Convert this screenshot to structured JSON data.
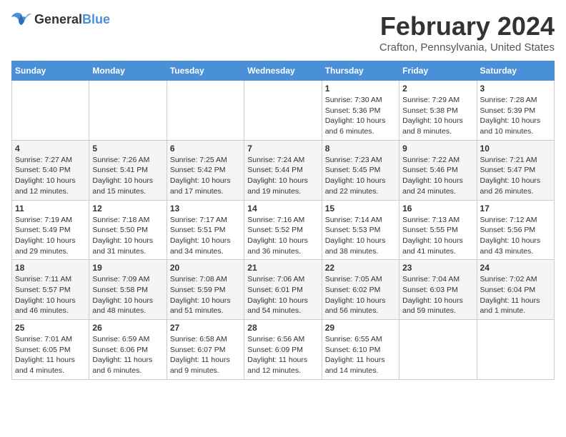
{
  "header": {
    "logo": {
      "general": "General",
      "blue": "Blue"
    },
    "title": "February 2024",
    "location": "Crafton, Pennsylvania, United States"
  },
  "weekdays": [
    "Sunday",
    "Monday",
    "Tuesday",
    "Wednesday",
    "Thursday",
    "Friday",
    "Saturday"
  ],
  "weeks": [
    [
      {
        "day": "",
        "info": ""
      },
      {
        "day": "",
        "info": ""
      },
      {
        "day": "",
        "info": ""
      },
      {
        "day": "",
        "info": ""
      },
      {
        "day": "1",
        "info": "Sunrise: 7:30 AM\nSunset: 5:36 PM\nDaylight: 10 hours\nand 6 minutes."
      },
      {
        "day": "2",
        "info": "Sunrise: 7:29 AM\nSunset: 5:38 PM\nDaylight: 10 hours\nand 8 minutes."
      },
      {
        "day": "3",
        "info": "Sunrise: 7:28 AM\nSunset: 5:39 PM\nDaylight: 10 hours\nand 10 minutes."
      }
    ],
    [
      {
        "day": "4",
        "info": "Sunrise: 7:27 AM\nSunset: 5:40 PM\nDaylight: 10 hours\nand 12 minutes."
      },
      {
        "day": "5",
        "info": "Sunrise: 7:26 AM\nSunset: 5:41 PM\nDaylight: 10 hours\nand 15 minutes."
      },
      {
        "day": "6",
        "info": "Sunrise: 7:25 AM\nSunset: 5:42 PM\nDaylight: 10 hours\nand 17 minutes."
      },
      {
        "day": "7",
        "info": "Sunrise: 7:24 AM\nSunset: 5:44 PM\nDaylight: 10 hours\nand 19 minutes."
      },
      {
        "day": "8",
        "info": "Sunrise: 7:23 AM\nSunset: 5:45 PM\nDaylight: 10 hours\nand 22 minutes."
      },
      {
        "day": "9",
        "info": "Sunrise: 7:22 AM\nSunset: 5:46 PM\nDaylight: 10 hours\nand 24 minutes."
      },
      {
        "day": "10",
        "info": "Sunrise: 7:21 AM\nSunset: 5:47 PM\nDaylight: 10 hours\nand 26 minutes."
      }
    ],
    [
      {
        "day": "11",
        "info": "Sunrise: 7:19 AM\nSunset: 5:49 PM\nDaylight: 10 hours\nand 29 minutes."
      },
      {
        "day": "12",
        "info": "Sunrise: 7:18 AM\nSunset: 5:50 PM\nDaylight: 10 hours\nand 31 minutes."
      },
      {
        "day": "13",
        "info": "Sunrise: 7:17 AM\nSunset: 5:51 PM\nDaylight: 10 hours\nand 34 minutes."
      },
      {
        "day": "14",
        "info": "Sunrise: 7:16 AM\nSunset: 5:52 PM\nDaylight: 10 hours\nand 36 minutes."
      },
      {
        "day": "15",
        "info": "Sunrise: 7:14 AM\nSunset: 5:53 PM\nDaylight: 10 hours\nand 38 minutes."
      },
      {
        "day": "16",
        "info": "Sunrise: 7:13 AM\nSunset: 5:55 PM\nDaylight: 10 hours\nand 41 minutes."
      },
      {
        "day": "17",
        "info": "Sunrise: 7:12 AM\nSunset: 5:56 PM\nDaylight: 10 hours\nand 43 minutes."
      }
    ],
    [
      {
        "day": "18",
        "info": "Sunrise: 7:11 AM\nSunset: 5:57 PM\nDaylight: 10 hours\nand 46 minutes."
      },
      {
        "day": "19",
        "info": "Sunrise: 7:09 AM\nSunset: 5:58 PM\nDaylight: 10 hours\nand 48 minutes."
      },
      {
        "day": "20",
        "info": "Sunrise: 7:08 AM\nSunset: 5:59 PM\nDaylight: 10 hours\nand 51 minutes."
      },
      {
        "day": "21",
        "info": "Sunrise: 7:06 AM\nSunset: 6:01 PM\nDaylight: 10 hours\nand 54 minutes."
      },
      {
        "day": "22",
        "info": "Sunrise: 7:05 AM\nSunset: 6:02 PM\nDaylight: 10 hours\nand 56 minutes."
      },
      {
        "day": "23",
        "info": "Sunrise: 7:04 AM\nSunset: 6:03 PM\nDaylight: 10 hours\nand 59 minutes."
      },
      {
        "day": "24",
        "info": "Sunrise: 7:02 AM\nSunset: 6:04 PM\nDaylight: 11 hours\nand 1 minute."
      }
    ],
    [
      {
        "day": "25",
        "info": "Sunrise: 7:01 AM\nSunset: 6:05 PM\nDaylight: 11 hours\nand 4 minutes."
      },
      {
        "day": "26",
        "info": "Sunrise: 6:59 AM\nSunset: 6:06 PM\nDaylight: 11 hours\nand 6 minutes."
      },
      {
        "day": "27",
        "info": "Sunrise: 6:58 AM\nSunset: 6:07 PM\nDaylight: 11 hours\nand 9 minutes."
      },
      {
        "day": "28",
        "info": "Sunrise: 6:56 AM\nSunset: 6:09 PM\nDaylight: 11 hours\nand 12 minutes."
      },
      {
        "day": "29",
        "info": "Sunrise: 6:55 AM\nSunset: 6:10 PM\nDaylight: 11 hours\nand 14 minutes."
      },
      {
        "day": "",
        "info": ""
      },
      {
        "day": "",
        "info": ""
      }
    ]
  ]
}
